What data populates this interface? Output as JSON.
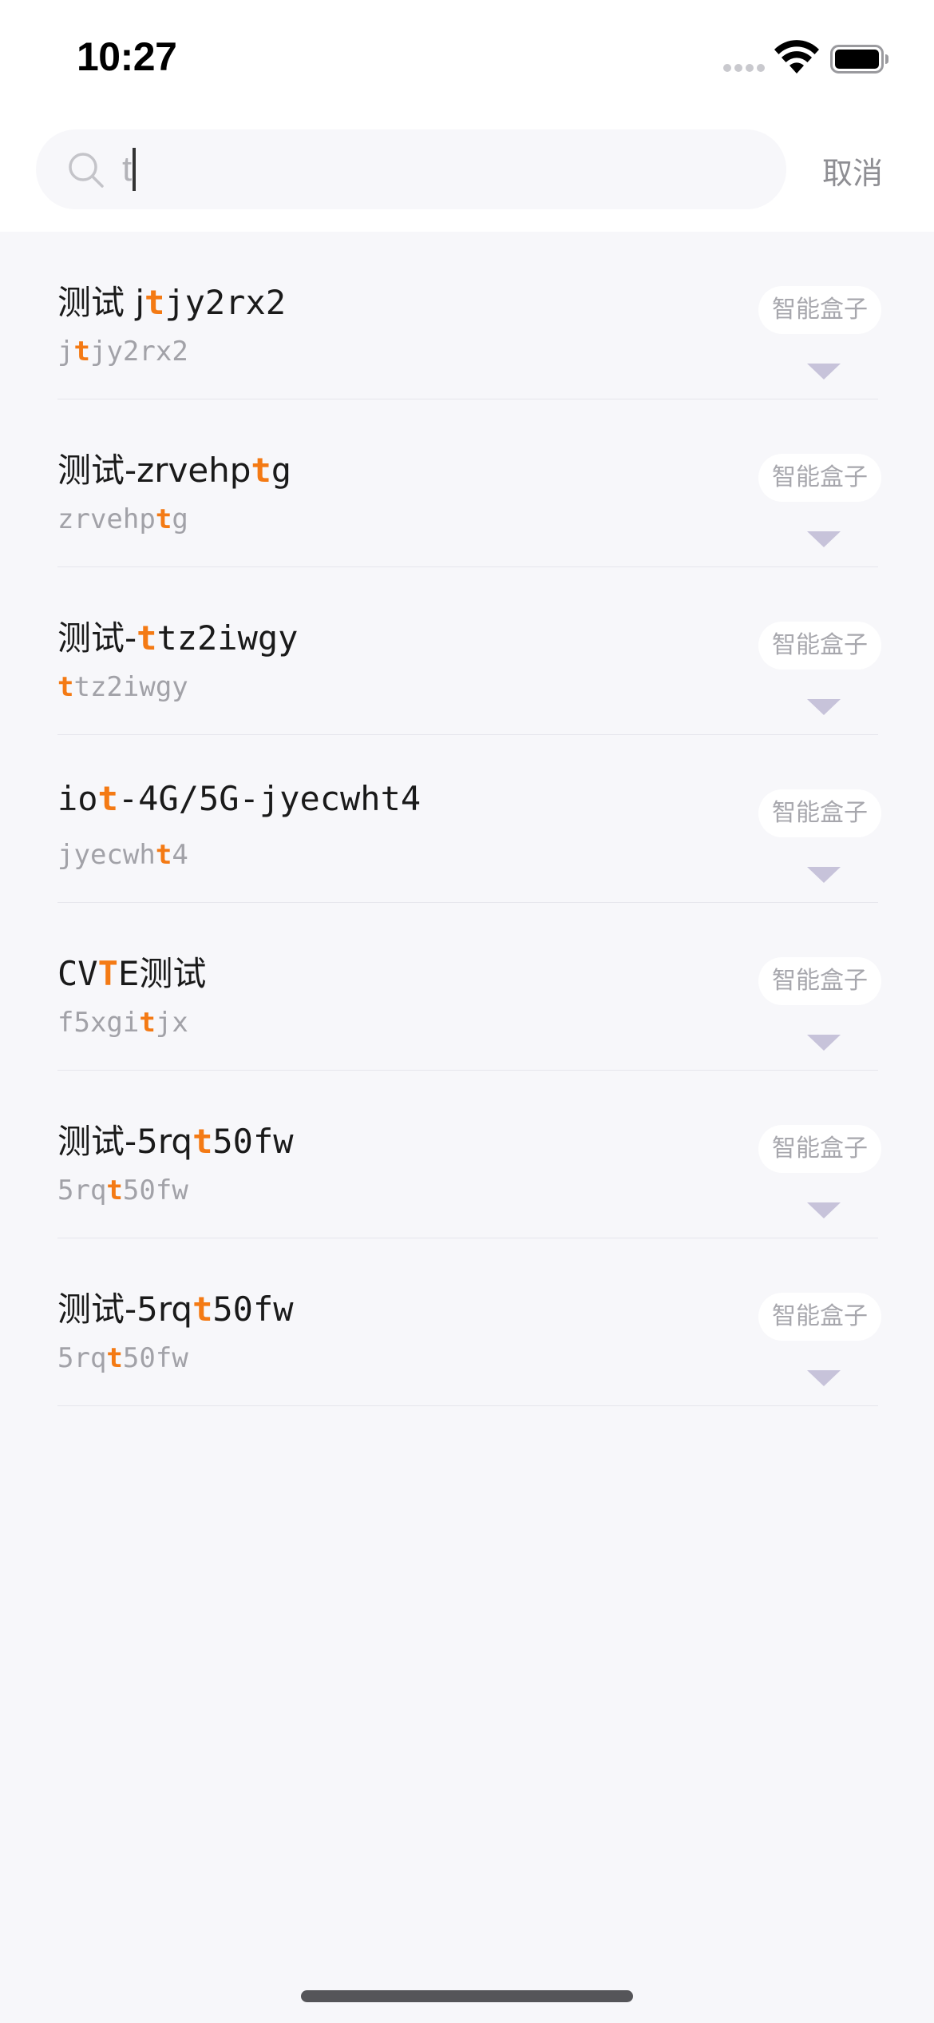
{
  "status_bar": {
    "time": "10:27"
  },
  "search": {
    "value": "t",
    "cancel_label": "取消"
  },
  "highlight_color": "#f47a14",
  "items": [
    {
      "title_parts": [
        {
          "t": "测试 j"
        },
        {
          "t": "t",
          "hl": true
        },
        {
          "t": "jy2rx2"
        }
      ],
      "subtitle_parts": [
        {
          "t": "j"
        },
        {
          "t": "t",
          "hl": true
        },
        {
          "t": "jy2rx2"
        }
      ],
      "tag": "智能盒子"
    },
    {
      "title_parts": [
        {
          "t": "测试-zrvehp"
        },
        {
          "t": "t",
          "hl": true
        },
        {
          "t": "g"
        }
      ],
      "subtitle_parts": [
        {
          "t": "zrvehp"
        },
        {
          "t": "t",
          "hl": true
        },
        {
          "t": "g"
        }
      ],
      "tag": "智能盒子"
    },
    {
      "title_parts": [
        {
          "t": "测试-"
        },
        {
          "t": "t",
          "hl": true
        },
        {
          "t": "tz2iwgy"
        }
      ],
      "subtitle_parts": [
        {
          "t": "t",
          "hl": true
        },
        {
          "t": "tz2iwgy"
        }
      ],
      "tag": "智能盒子"
    },
    {
      "title_parts": [
        {
          "t": "io"
        },
        {
          "t": "t",
          "hl": true
        },
        {
          "t": "-4G/5G-jyecwht4"
        }
      ],
      "subtitle_parts": [
        {
          "t": "jyecwh"
        },
        {
          "t": "t",
          "hl": true
        },
        {
          "t": "4"
        }
      ],
      "tag": "智能盒子"
    },
    {
      "title_parts": [
        {
          "t": "CV"
        },
        {
          "t": "T",
          "hl": true
        },
        {
          "t": "E测试"
        }
      ],
      "subtitle_parts": [
        {
          "t": "f5xgi"
        },
        {
          "t": "t",
          "hl": true
        },
        {
          "t": "jx"
        }
      ],
      "tag": "智能盒子"
    },
    {
      "title_parts": [
        {
          "t": "测试-5rq"
        },
        {
          "t": "t",
          "hl": true
        },
        {
          "t": "50fw"
        }
      ],
      "subtitle_parts": [
        {
          "t": "5rq"
        },
        {
          "t": "t",
          "hl": true
        },
        {
          "t": "50fw"
        }
      ],
      "tag": "智能盒子"
    },
    {
      "title_parts": [
        {
          "t": "测试-5rq"
        },
        {
          "t": "t",
          "hl": true
        },
        {
          "t": "50fw"
        }
      ],
      "subtitle_parts": [
        {
          "t": "5rq"
        },
        {
          "t": "t",
          "hl": true
        },
        {
          "t": "50fw"
        }
      ],
      "tag": "智能盒子"
    }
  ]
}
